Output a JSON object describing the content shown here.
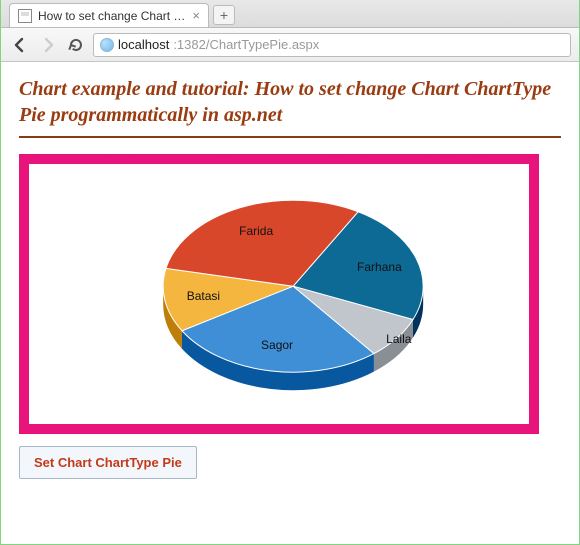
{
  "browser": {
    "tab_title": "How to set change Chart C...",
    "url_host": "localhost",
    "url_rest": ":1382/ChartTypePie.aspx"
  },
  "page": {
    "heading": "Chart example and tutorial: How to set change Chart ChartType Pie programmatically in asp.net",
    "button_label": "Set Chart ChartType Pie"
  },
  "chart_data": {
    "type": "pie",
    "title": "",
    "series": [
      {
        "name": "Farhana",
        "value": 23,
        "color": "#0d6a94"
      },
      {
        "name": "Laila",
        "value": 8,
        "color": "#c1c6cc"
      },
      {
        "name": "Sagor",
        "value": 27,
        "color": "#3f8fd6"
      },
      {
        "name": "Batasi",
        "value": 12,
        "color": "#f4b63f"
      },
      {
        "name": "Farida",
        "value": 30,
        "color": "#d9472b"
      }
    ]
  }
}
